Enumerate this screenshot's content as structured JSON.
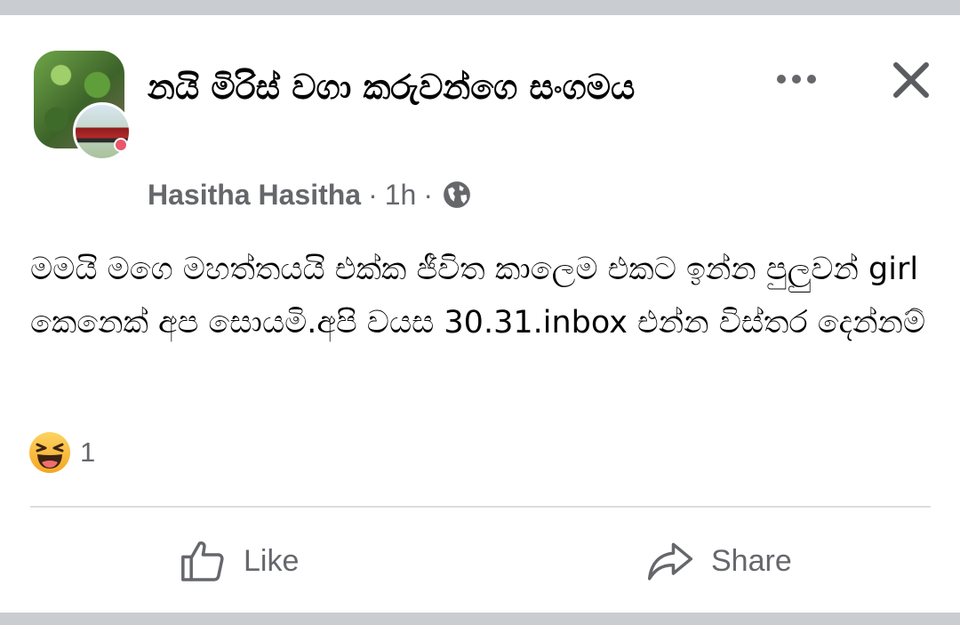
{
  "post": {
    "group_name": "නයි මිරිස් වගා කරුවන්ගෙ සංගමය",
    "author": "Hasitha Hasitha",
    "time": "1h",
    "separator": "·",
    "privacy_icon": "globe-icon",
    "body": "මමයි මගෙ මහත්තයයි එක්ක ජීවිත කාලෙම එකට ඉන්න පුලුවන් girl කෙනෙක් අප සොයමි.අපි වයස 30.31.inbox එන්න විස්තර දෙන්නම්"
  },
  "reactions": {
    "icon": "haha-emoji-icon",
    "count": "1"
  },
  "actions": {
    "like_label": "Like",
    "share_label": "Share"
  },
  "header_icons": {
    "more": "more-options-icon",
    "close": "close-icon"
  },
  "colors": {
    "background": "#c9ccd1",
    "card": "#ffffff",
    "text_primary": "#050505",
    "text_secondary": "#65676b",
    "divider": "#dadde1",
    "haha_yellow": "#f7b125"
  }
}
